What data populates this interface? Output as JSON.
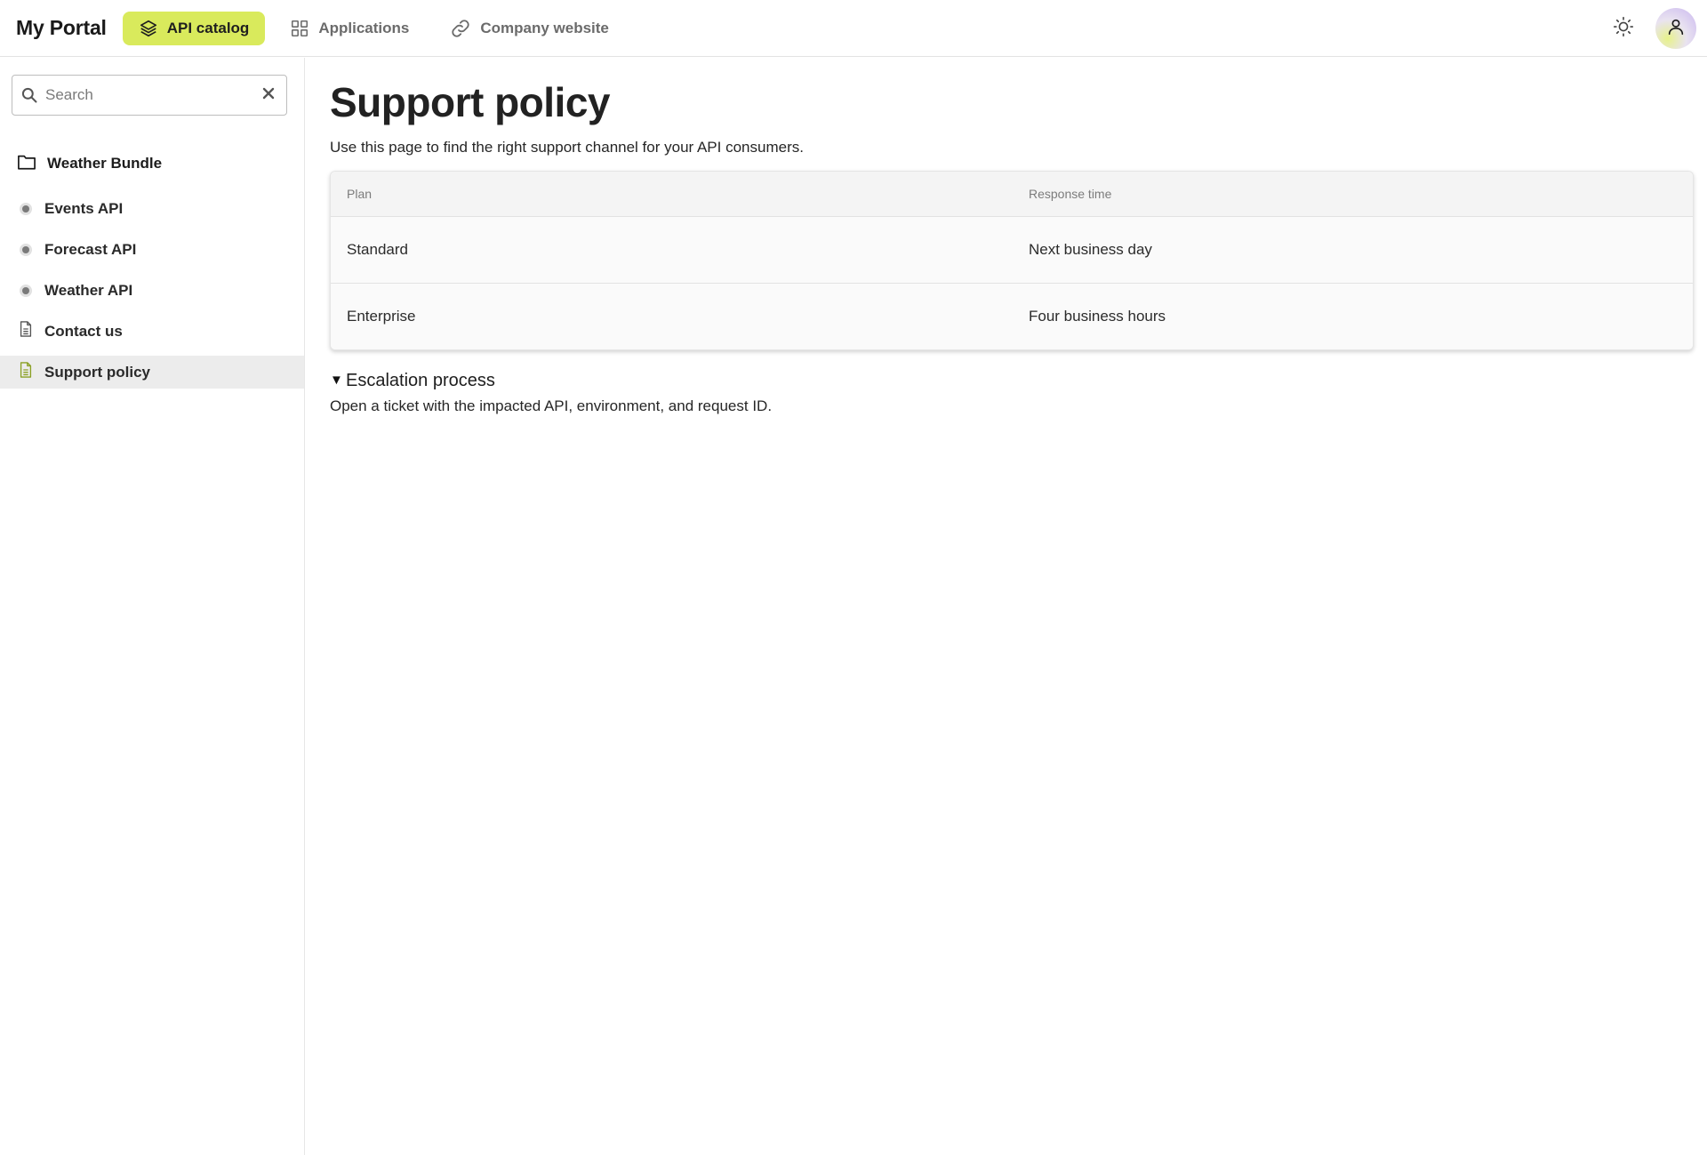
{
  "header": {
    "brand": "My Portal",
    "nav": [
      {
        "label": "API catalog",
        "icon": "layers-icon",
        "active": true
      },
      {
        "label": "Applications",
        "icon": "grid-icon",
        "active": false
      },
      {
        "label": "Company website",
        "icon": "link-icon",
        "active": false
      }
    ],
    "theme_icon": "sun-icon",
    "avatar_icon": "user-icon",
    "accent_color": "#d9ea5c"
  },
  "sidebar": {
    "search": {
      "placeholder": "Search",
      "value": ""
    },
    "folder": {
      "label": "Weather Bundle",
      "icon": "folder-icon"
    },
    "items": [
      {
        "label": "Events API",
        "icon": "api-dot-icon",
        "selected": false
      },
      {
        "label": "Forecast API",
        "icon": "api-dot-icon",
        "selected": false
      },
      {
        "label": "Weather API",
        "icon": "api-dot-icon",
        "selected": false
      },
      {
        "label": "Contact us",
        "icon": "document-icon",
        "selected": false
      },
      {
        "label": "Support policy",
        "icon": "document-icon",
        "selected": true
      }
    ]
  },
  "main": {
    "title": "Support policy",
    "lead": "Use this page to find the right support channel for your API consumers.",
    "table": {
      "columns": [
        "Plan",
        "Response time"
      ],
      "rows": [
        [
          "Standard",
          "Next business day"
        ],
        [
          "Enterprise",
          "Four business hours"
        ]
      ]
    },
    "details": {
      "summary": "Escalation process",
      "body": "Open a ticket with the impacted API, environment, and request ID.",
      "open": true
    }
  }
}
